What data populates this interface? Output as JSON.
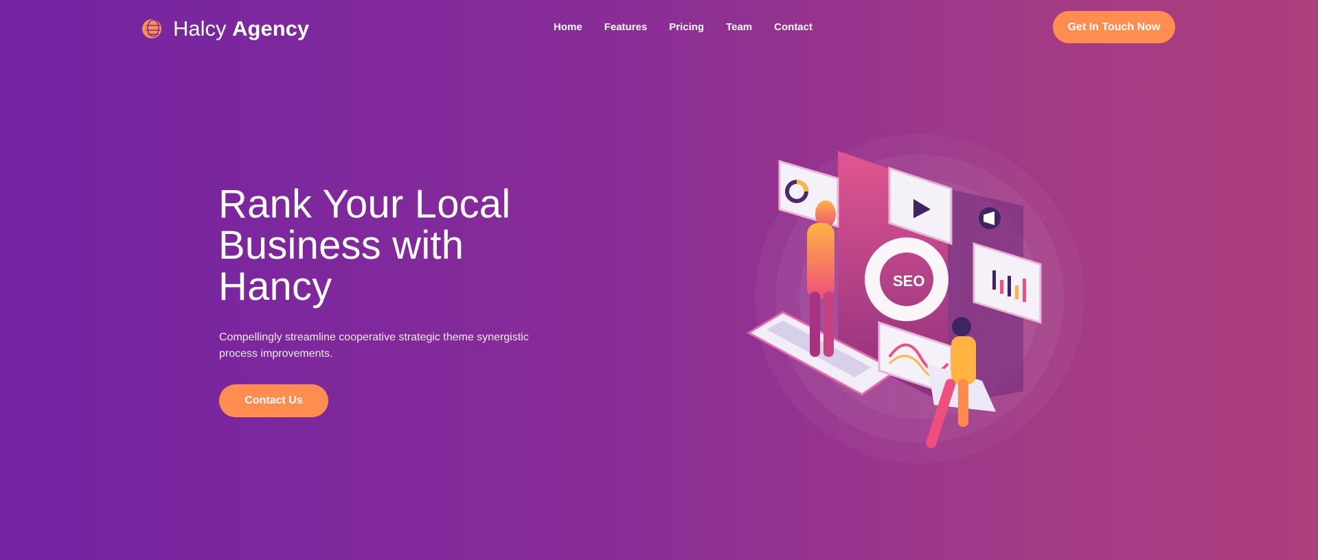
{
  "header": {
    "brand_light": "Halcy",
    "brand_bold": "Agency",
    "logo_icon": "globe-icon",
    "nav": [
      {
        "label": "Home"
      },
      {
        "label": "Features"
      },
      {
        "label": "Pricing"
      },
      {
        "label": "Team"
      },
      {
        "label": "Contact"
      }
    ],
    "cta_label": "Get In Touch Now"
  },
  "hero": {
    "title": "Rank Your Local Business with Hancy",
    "text": "Compellingly streamline cooperative strategic theme synergistic process improvements.",
    "button_label": "Contact Us"
  },
  "illustration": {
    "badge_text": "SEO"
  },
  "colors": {
    "accent": "#fe8d4f",
    "bg_start": "#7323a2",
    "bg_end": "#ad3f7e"
  }
}
